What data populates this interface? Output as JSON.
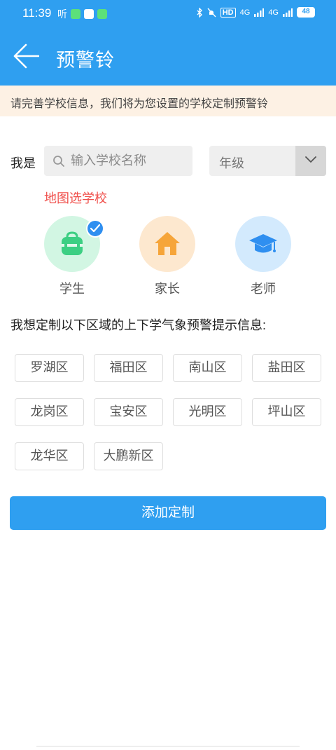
{
  "status_bar": {
    "time": "11:39",
    "app_icon_text": "听",
    "battery": "48",
    "network1": "4G",
    "network2": "4G",
    "hd": "HD"
  },
  "header": {
    "title": "预警铃",
    "back_icon": "arrow-left-icon"
  },
  "notice": "请完善学校信息，我们将为您设置的学校定制预警铃",
  "form": {
    "iam_label": "我是",
    "search_placeholder": "输入学校名称",
    "search_value": "",
    "grade_value": "年级",
    "map_link": "地图选学校"
  },
  "roles": [
    {
      "label": "学生",
      "icon": "backpack-icon",
      "selected": true
    },
    {
      "label": "家长",
      "icon": "house-icon",
      "selected": false
    },
    {
      "label": "老师",
      "icon": "graduation-cap-icon",
      "selected": false
    }
  ],
  "districts_title": "我想定制以下区域的上下学气象预警提示信息:",
  "districts": [
    "罗湖区",
    "福田区",
    "南山区",
    "盐田区",
    "龙岗区",
    "宝安区",
    "光明区",
    "坪山区",
    "龙华区",
    "大鹏新区"
  ],
  "add_button": "添加定制",
  "colors": {
    "primary": "#2f9ff0",
    "notice_bg": "#fdf1e4",
    "link_red": "#f0504c",
    "student": "#3ccf83",
    "parent": "#f6a53a",
    "teacher": "#2f8ff0"
  }
}
